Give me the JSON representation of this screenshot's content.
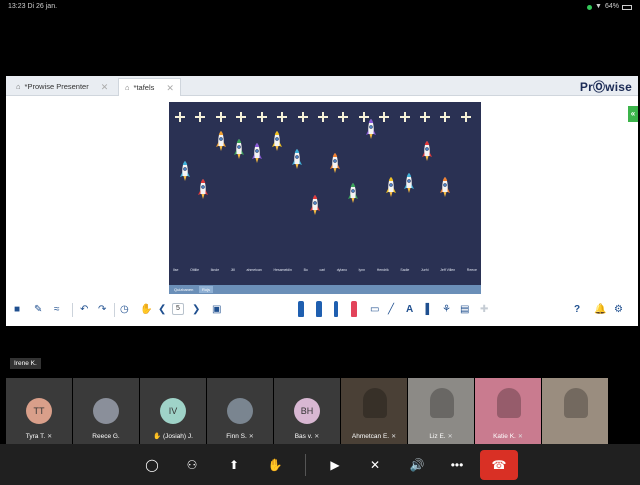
{
  "statusbar": {
    "time_date": "13:23  Di 26 jan.",
    "battery": "64%"
  },
  "presenter": {
    "tabs": [
      {
        "label": "*Prowise Presenter",
        "active": false
      },
      {
        "label": "*tafels",
        "active": true
      }
    ],
    "logo": "PrⓄwise",
    "side_toggle": "«",
    "canvas": {
      "names": [
        "Ilse",
        "Ottilie",
        "Iknde",
        "Jill",
        "ahmetcan",
        "Hesameldin",
        "Bo",
        "carl",
        "dylano",
        "lynn",
        "Hendrik",
        "Sadie",
        "Jurhi",
        "Jeff Villen",
        "Reece"
      ],
      "bottom_buttons": [
        "Quizbanen",
        "Rojs"
      ]
    },
    "toolbar": {
      "page_number": "5",
      "colors": {
        "pen1": "#1f5fb0",
        "pen2": "#1f5fb0",
        "pen3": "#1f5fb0",
        "marker": "#e2435a",
        "accent": "#1f4f8f"
      }
    }
  },
  "speaker": "Irene K.",
  "participants": [
    {
      "name": "Tyra T.",
      "initials": "TT",
      "avatar_color": "#d99f8a",
      "type": "initials",
      "muted": true
    },
    {
      "name": "Reece G.",
      "initials": "",
      "avatar_color": "#8a8f9a",
      "type": "photo",
      "muted": false
    },
    {
      "name": "(Josiah) J.",
      "initials": "IV",
      "avatar_color": "#9fd3c8",
      "type": "initials",
      "muted": false,
      "hand": true
    },
    {
      "name": "Finn S.",
      "initials": "",
      "avatar_color": "#7a8590",
      "type": "photo",
      "muted": true
    },
    {
      "name": "Bas v.",
      "initials": "BH",
      "avatar_color": "#d8b7d2",
      "type": "initials",
      "muted": true
    },
    {
      "name": "Ahmetcan E.",
      "initials": "",
      "avatar_color": "#4a4036",
      "type": "video",
      "muted": true
    },
    {
      "name": "Liz E.",
      "initials": "",
      "avatar_color": "#8c8a86",
      "type": "video",
      "muted": true
    },
    {
      "name": "Katie K.",
      "initials": "",
      "avatar_color": "#c97b8f",
      "type": "video",
      "muted": true
    },
    {
      "name": "",
      "initials": "",
      "avatar_color": "#9a8d7f",
      "type": "video",
      "muted": false
    }
  ],
  "controls": [
    "chat-icon",
    "participants-icon",
    "share-icon",
    "raise-hand-icon",
    "camera-icon",
    "mic-off-icon",
    "speaker-icon",
    "more-icon",
    "hangup-icon"
  ]
}
